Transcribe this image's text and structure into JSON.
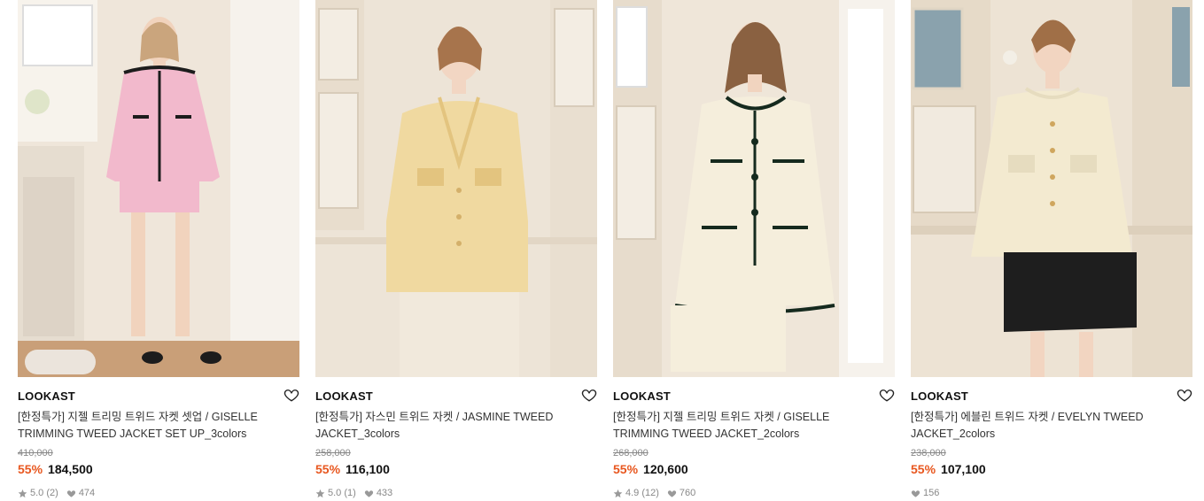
{
  "products": [
    {
      "brand": "LOOKAST",
      "name": "[한정특가] 지젤 트리밍 트위드 자켓 셋업 / GISELLE TRIMMING TWEED JACKET SET UP_3colors",
      "original_price": "410,000",
      "discount": "55%",
      "sale_price": "184,500",
      "rating": "5.0",
      "review_count": "(2)",
      "likes": "474",
      "jacket_color": "#f2b9cc",
      "trim_color": "#1c1c1c",
      "bottom_color": "#f2b9cc"
    },
    {
      "brand": "LOOKAST",
      "name": "[한정특가] 자스민 트위드 자켓 / JASMINE TWEED JACKET_3colors",
      "original_price": "258,000",
      "discount": "55%",
      "sale_price": "116,100",
      "rating": "5.0",
      "review_count": "(1)",
      "likes": "433",
      "jacket_color": "#f0d9a0",
      "trim_color": "#e3c47f",
      "bottom_color": "#f1e9dc"
    },
    {
      "brand": "LOOKAST",
      "name": "[한정특가] 지젤 트리밍 트위드 자켓 / GISELLE TRIMMING TWEED JACKET_2colors",
      "original_price": "268,000",
      "discount": "55%",
      "sale_price": "120,600",
      "rating": "4.9",
      "review_count": "(12)",
      "likes": "760",
      "jacket_color": "#f5eedc",
      "trim_color": "#152a1e",
      "bottom_color": "#f5eedc"
    },
    {
      "brand": "LOOKAST",
      "name": "[한정특가] 에블린 트위드 자켓 / EVELYN TWEED JACKET_2colors",
      "original_price": "238,000",
      "discount": "55%",
      "sale_price": "107,100",
      "rating": "",
      "review_count": "",
      "likes": "156",
      "jacket_color": "#f3ead0",
      "trim_color": "#e6dcbf",
      "bottom_color": "#1e1e1e"
    }
  ],
  "icons": {
    "heart": "heart-outline-icon",
    "star": "star-icon",
    "like": "heart-filled-icon"
  }
}
